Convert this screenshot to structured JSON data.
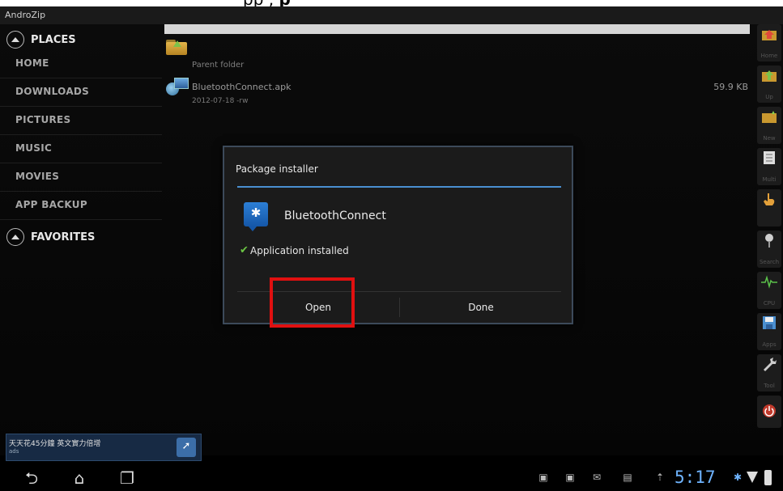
{
  "app": {
    "title": "AndroZip"
  },
  "caption": {
    "prefix": "pp",
    "bold": "p"
  },
  "sidebar": {
    "places_label": "PLACES",
    "items": [
      {
        "label": "HOME"
      },
      {
        "label": "DOWNLOADS"
      },
      {
        "label": "PICTURES"
      },
      {
        "label": "MUSIC"
      },
      {
        "label": "MOVIES"
      },
      {
        "label": "APP BACKUP"
      }
    ],
    "favorites_label": "FAVORITES"
  },
  "files": [
    {
      "name": "Parent folder",
      "sub": "",
      "size": "",
      "icon": "folder-up-icon"
    },
    {
      "name": "BluetoothConnect.apk",
      "sub": "2012-07-18 -rw",
      "size": "59.9 KB",
      "icon": "apk-icon"
    }
  ],
  "toolbar": [
    {
      "label": "Home",
      "icon": "home-folder-icon"
    },
    {
      "label": "Up",
      "icon": "up-folder-icon"
    },
    {
      "label": "New",
      "icon": "new-folder-icon"
    },
    {
      "label": "Multi",
      "icon": "multi-select-icon"
    },
    {
      "label": "",
      "icon": "hand-icon"
    },
    {
      "label": "Search",
      "icon": "search-icon"
    },
    {
      "label": "CPU",
      "icon": "cpu-icon"
    },
    {
      "label": "Apps",
      "icon": "save-icon"
    },
    {
      "label": "Tool",
      "icon": "tool-icon"
    },
    {
      "label": "",
      "icon": "power-icon"
    }
  ],
  "dialog": {
    "title": "Package installer",
    "app_name": "BluetoothConnect",
    "status": "Application installed",
    "open_label": "Open",
    "done_label": "Done"
  },
  "ad": {
    "text": "天天花45分鐘 英文實力倍增",
    "sub": "ads"
  },
  "statusbar": {
    "time": "5:17"
  },
  "colors": {
    "accent": "#4a8fd0",
    "highlight": "#e01010",
    "clock": "#6fb4ff",
    "check": "#6cc644"
  }
}
